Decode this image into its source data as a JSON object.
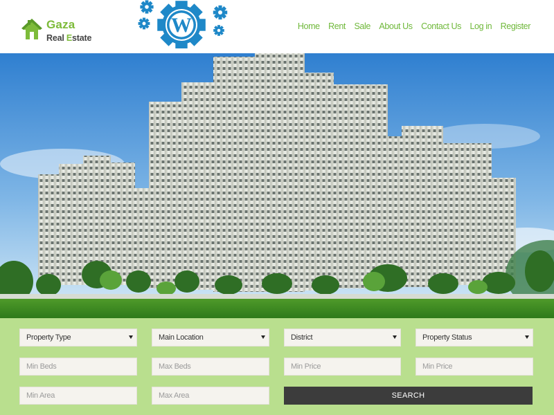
{
  "header": {
    "logo": {
      "line1": "Gaza",
      "line2_part1": "Real ",
      "line2_part2": "E",
      "line2_part3": "state"
    },
    "nav": [
      "Home",
      "Rent",
      "Sale",
      "About Us",
      "Contact Us",
      "Log in",
      "Register"
    ]
  },
  "search": {
    "property_type": "Property Type",
    "main_location": "Main Location",
    "district": "District",
    "property_status": "Property Status",
    "min_beds": "Min Beds",
    "max_beds": "Max Beds",
    "min_price": "Min Price",
    "max_price": "Min Price",
    "min_area": "Min Area",
    "max_area": "Max Area",
    "button": "SEARCH"
  },
  "colors": {
    "brand_green": "#7dbb3a",
    "nav_green": "#6fb83a",
    "panel_bg": "#b9df8e",
    "button_bg": "#3c3c3c"
  },
  "icons": {
    "logo": "house-icon",
    "badge": "wordpress-gears-icon"
  }
}
